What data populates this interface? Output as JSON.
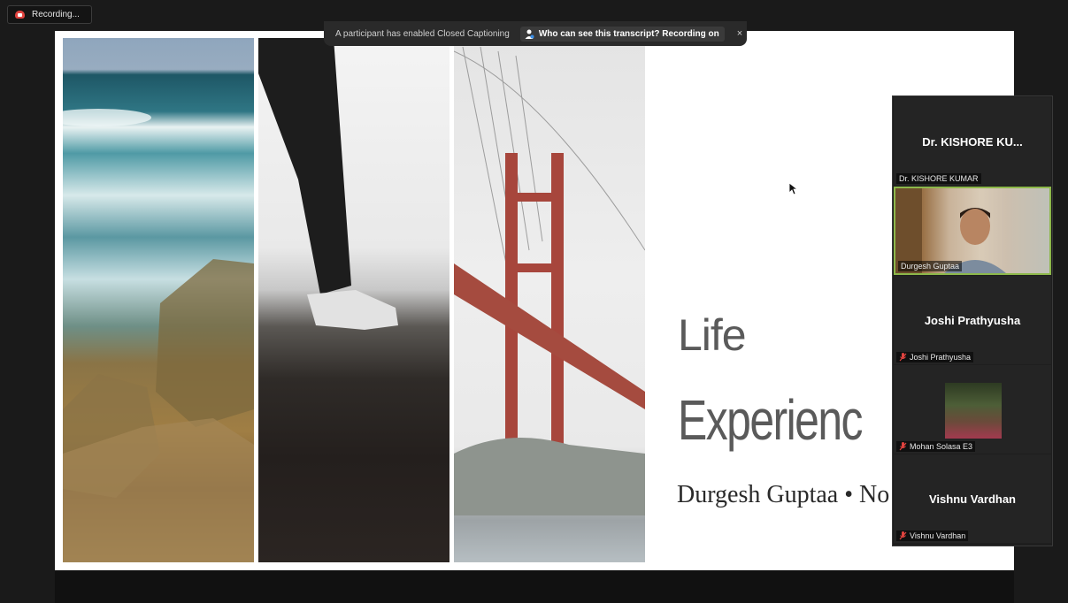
{
  "recording": {
    "label": "Recording..."
  },
  "caption_notice": {
    "text": "A participant has enabled Closed Captioning",
    "button": "Who can see this transcript? Recording on",
    "close": "×"
  },
  "slide": {
    "title_line1": "Life",
    "title_line2": "Experienc",
    "subtitle": "Durgesh Guptaa • No"
  },
  "participants": [
    {
      "display": "Dr. KISHORE KU...",
      "name": "Dr. KISHORE KUMAR"
    },
    {
      "name": "Durgesh Guptaa"
    },
    {
      "display": "Joshi Prathyusha",
      "name": "Joshi Prathyusha"
    },
    {
      "name": "Mohan Solasa E3"
    },
    {
      "display": "Vishnu Vardhan",
      "name": "Vishnu Vardhan"
    }
  ],
  "colors": {
    "muted_mic": "#e0433f",
    "active_speaker": "#8db84a",
    "record": "#e0433f"
  }
}
